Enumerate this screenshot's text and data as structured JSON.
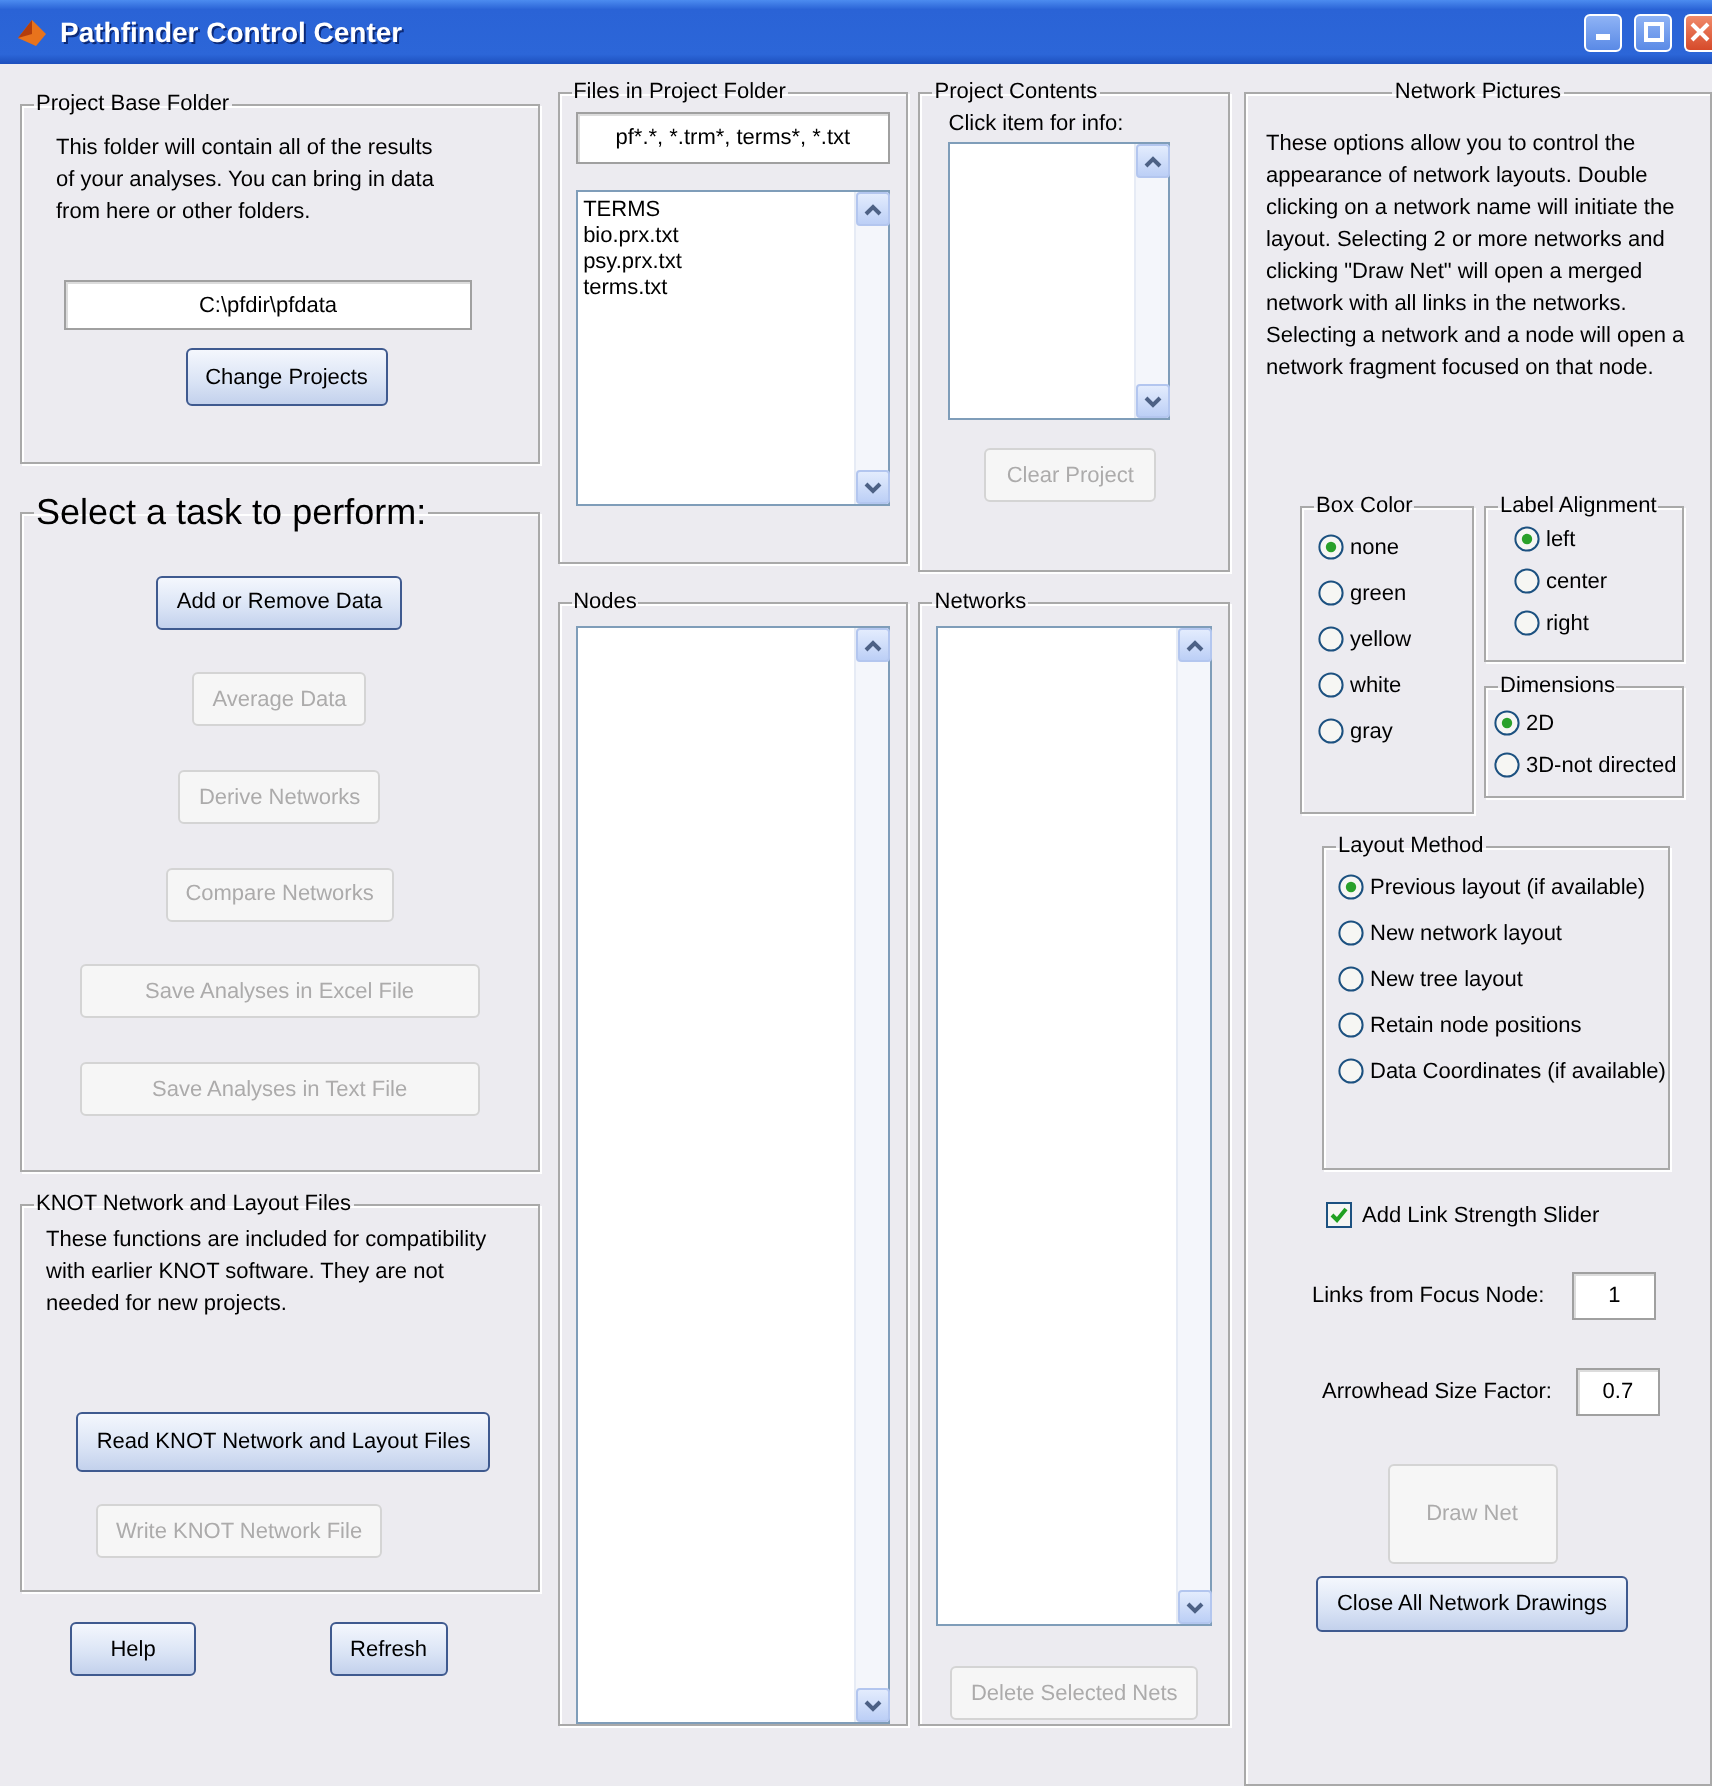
{
  "window": {
    "title": "Pathfinder Control Center"
  },
  "project_base_folder": {
    "title": "Project Base Folder",
    "description": "This folder will contain all of the results of your analyses. You can bring in data from here or other folders.",
    "path": "C:\\pfdir\\pfdata",
    "button": {
      "label": "Change Projects",
      "disabled": false
    }
  },
  "tasks": {
    "title": "Select a task to perform:",
    "buttons": [
      {
        "label": "Add or Remove Data",
        "disabled": false
      },
      {
        "label": "Average Data",
        "disabled": true
      },
      {
        "label": "Derive Networks",
        "disabled": true
      },
      {
        "label": "Compare Networks",
        "disabled": true
      },
      {
        "label": "Save Analyses in Excel File",
        "disabled": true
      },
      {
        "label": "Save Analyses in Text File",
        "disabled": true
      }
    ]
  },
  "knot_files": {
    "title": "KNOT Network and Layout Files",
    "description": "These functions are included for compatibility with earlier KNOT software. They are not needed for new projects.",
    "buttons": [
      {
        "label": "Read KNOT Network and Layout Files",
        "disabled": false
      },
      {
        "label": "Write KNOT Network File",
        "disabled": true
      }
    ]
  },
  "footer_buttons": [
    {
      "label": "Help",
      "disabled": false
    },
    {
      "label": "Refresh",
      "disabled": false
    }
  ],
  "files": {
    "title": "Files in Project Folder",
    "filter": "pf*.*, *.trm*, terms*, *.txt",
    "items": [
      "TERMS",
      "bio.prx.txt",
      "psy.prx.txt",
      "terms.txt"
    ]
  },
  "project_contents": {
    "title": "Project Contents",
    "hint": "Click item for info:",
    "button": {
      "label": "Clear Project",
      "disabled": true
    }
  },
  "nodes": {
    "title": "Nodes"
  },
  "networks": {
    "title": "Networks",
    "button": {
      "label": "Delete Selected Nets",
      "disabled": true
    }
  },
  "network_pictures": {
    "title": "Network Pictures",
    "description": "These options allow you to control the appearance of network layouts. Double clicking on a network name will initiate the layout. Selecting 2 or more networks and clicking \"Draw Net\" will open a merged network with all links in the networks. Selecting a network and a node will open a network fragment focused on that node.",
    "box_color": {
      "title": "Box Color",
      "options": [
        {
          "label": "none",
          "selected": true
        },
        {
          "label": "green",
          "selected": false
        },
        {
          "label": "yellow",
          "selected": false
        },
        {
          "label": "white",
          "selected": false
        },
        {
          "label": "gray",
          "selected": false
        }
      ]
    },
    "label_alignment": {
      "title": "Label Alignment",
      "options": [
        {
          "label": "left",
          "selected": true
        },
        {
          "label": "center",
          "selected": false
        },
        {
          "label": "right",
          "selected": false
        }
      ]
    },
    "dimensions": {
      "title": "Dimensions",
      "options": [
        {
          "label": "2D",
          "selected": true
        },
        {
          "label": "3D-not directed",
          "selected": false
        }
      ]
    },
    "layout_method": {
      "title": "Layout Method",
      "options": [
        {
          "label": "Previous layout (if available)",
          "selected": true
        },
        {
          "label": "New network layout",
          "selected": false
        },
        {
          "label": "New tree layout",
          "selected": false
        },
        {
          "label": "Retain node positions",
          "selected": false
        },
        {
          "label": "Data Coordinates (if available)",
          "selected": false
        }
      ]
    },
    "link_strength_slider": {
      "label": "Add Link Strength Slider",
      "checked": true
    },
    "links_from_focus_node": {
      "label": "Links from Focus Node:",
      "value": "1"
    },
    "arrowhead_size_factor": {
      "label": "Arrowhead Size Factor:",
      "value": "0.7"
    },
    "buttons": [
      {
        "label": "Draw Net",
        "disabled": true
      },
      {
        "label": "Close All Network Drawings",
        "disabled": false
      }
    ]
  }
}
